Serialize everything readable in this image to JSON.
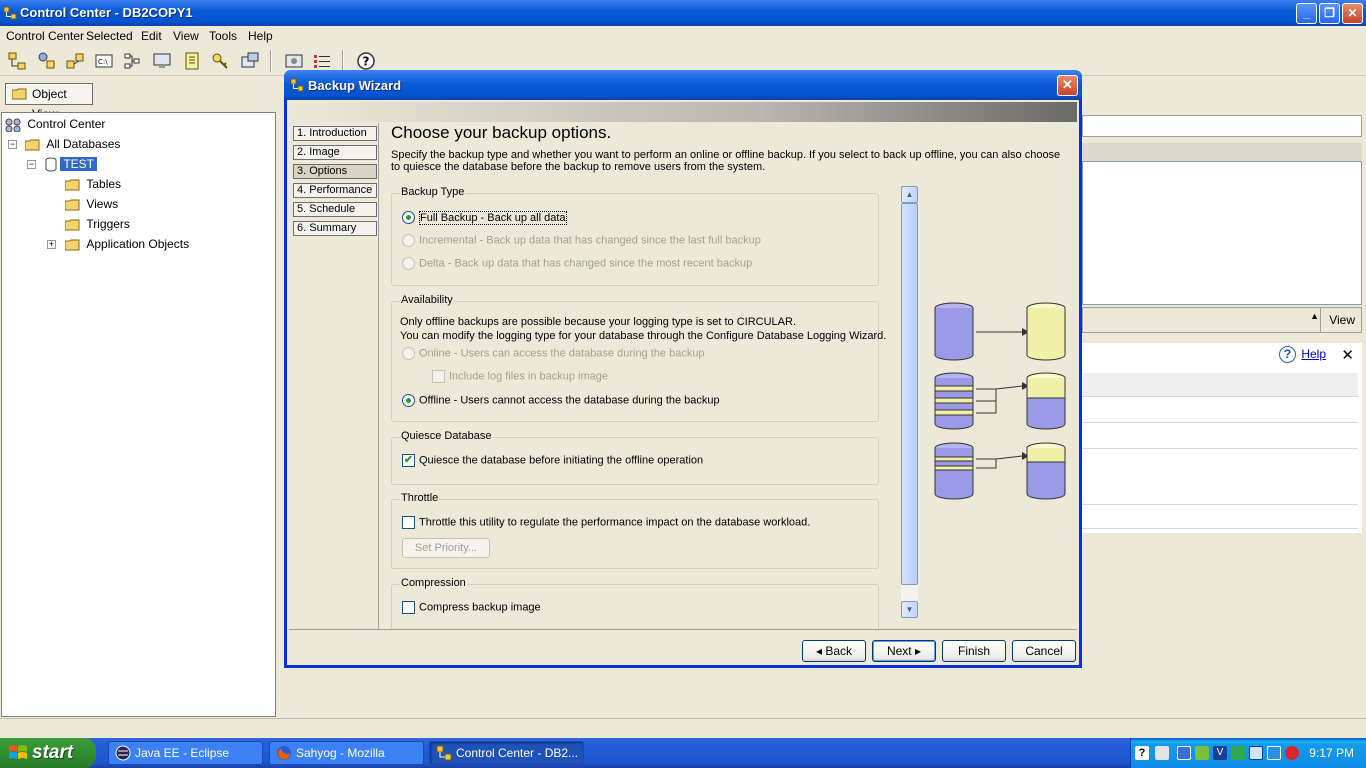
{
  "window": {
    "title": "Control Center - DB2COPY1"
  },
  "menu": [
    "Control Center",
    "Selected",
    "Edit",
    "View",
    "Tools",
    "Help"
  ],
  "left": {
    "object_view_label": "Object View",
    "tree": [
      {
        "label": "Control Center",
        "selected": false
      },
      {
        "label": "All Databases",
        "selected": false
      },
      {
        "label": "TEST",
        "selected": true
      },
      {
        "label": "Tables",
        "selected": false
      },
      {
        "label": "Views",
        "selected": false
      },
      {
        "label": "Triggers",
        "selected": false
      },
      {
        "label": "Application Objects",
        "selected": false
      }
    ]
  },
  "right_panel": {
    "view_label": "View",
    "help_label": "Help"
  },
  "dialog": {
    "title": "Backup Wizard",
    "steps": [
      "1. Introduction",
      "2. Image",
      "3. Options",
      "4. Performance",
      "5. Schedule",
      "6. Summary"
    ],
    "current_step": "3. Options",
    "heading": "Choose your backup options.",
    "description": "Specify the backup type and whether you want to perform an online or offline backup. If you select to back up offline, you can also choose to quiesce the database before the backup to remove users from the system.",
    "backup_type": {
      "title": "Backup Type",
      "options": [
        {
          "label": "Full Backup  -  Back up all data",
          "selected": true,
          "enabled": true
        },
        {
          "label": "Incremental  -  Back up data that has changed since the last full backup",
          "selected": false,
          "enabled": false
        },
        {
          "label": "Delta  -  Back up data that has changed since the most recent backup",
          "selected": false,
          "enabled": false
        }
      ]
    },
    "availability": {
      "title": "Availability",
      "note_line1": "Only offline backups are possible because your logging type is set to CIRCULAR.",
      "note_line2": "You can modify the logging type for your database through the Configure Database Logging Wizard.",
      "online_label": "Online  -  Users can access the database during the backup",
      "include_logs_label": "Include log files in backup image",
      "offline_label": "Offline  -  Users cannot access the database during the backup",
      "selected": "offline"
    },
    "quiesce": {
      "title": "Quiesce Database",
      "label": "Quiesce the database before initiating the offline operation",
      "checked": true
    },
    "throttle": {
      "title": "Throttle",
      "label": "Throttle this utility to regulate the performance impact on the database workload.",
      "checked": false,
      "priority_button": "Set Priority..."
    },
    "compression": {
      "title": "Compression",
      "label": "Compress backup image",
      "checked": false
    },
    "buttons": {
      "back": "Back",
      "next": "Next",
      "finish": "Finish",
      "cancel": "Cancel"
    }
  },
  "taskbar": {
    "start": "start",
    "tasks": [
      {
        "label": "Java EE - Eclipse",
        "icon": "eclipse-icon"
      },
      {
        "label": "Sahyog - Mozilla Firefox",
        "icon": "firefox-icon"
      },
      {
        "label": "Control Center - DB2...",
        "icon": "db2-icon",
        "active": true
      }
    ],
    "clock": "9:17 PM"
  },
  "colors": {
    "xp_blue": "#0a5ad8",
    "selection": "#316ac5",
    "radio_dot": "#21a121",
    "db_blue": "#9a9ae6",
    "db_yellow": "#f0f0a8"
  }
}
